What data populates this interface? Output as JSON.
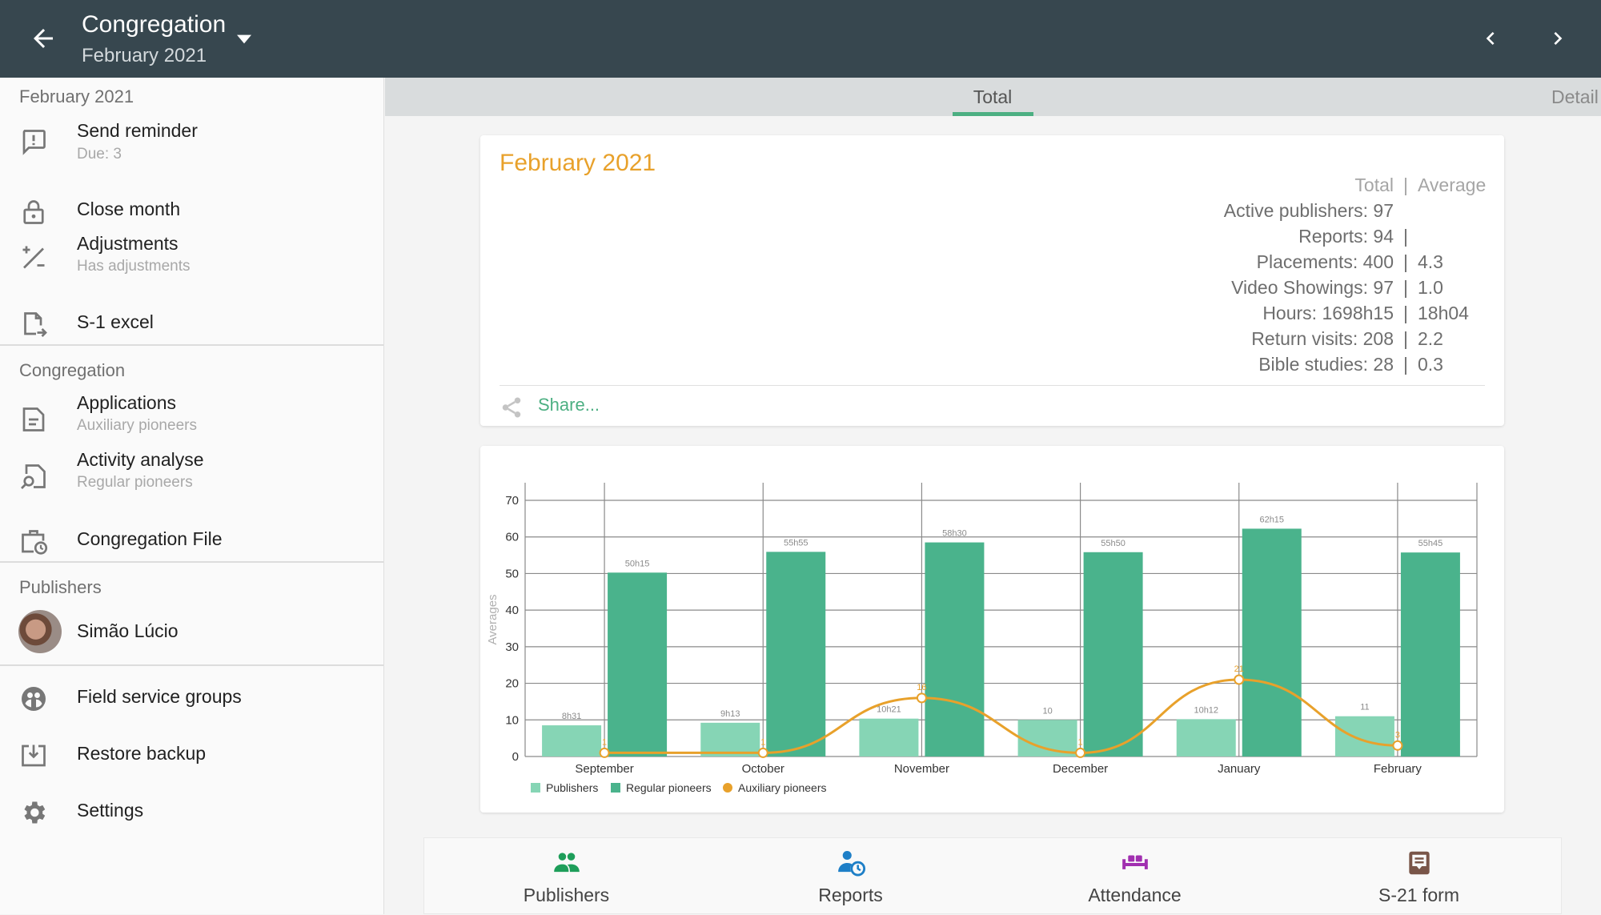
{
  "appbar": {
    "title": "Congregation",
    "subtitle": "February 2021",
    "back_icon": "arrow-left-icon",
    "dropdown_icon": "caret-down-icon",
    "prev_icon": "chevron-left-icon",
    "next_icon": "chevron-right-icon",
    "color": "#37474f"
  },
  "sidebar": {
    "sections": [
      {
        "header": "February 2021",
        "items": [
          {
            "label": "Send reminder",
            "sub": "Due: 3",
            "icon": "feedback-icon"
          },
          {
            "label": "Close month",
            "sub": "",
            "icon": "lock-icon"
          },
          {
            "label": "Adjustments",
            "sub": "Has adjustments",
            "icon": "plus-minus-icon"
          },
          {
            "label": "S-1 excel",
            "sub": "",
            "icon": "file-export-icon"
          }
        ]
      },
      {
        "header": "Congregation",
        "items": [
          {
            "label": "Applications",
            "sub": "Auxiliary pioneers",
            "icon": "document-icon"
          },
          {
            "label": "Activity analyse",
            "sub": "Regular pioneers",
            "icon": "file-search-icon"
          },
          {
            "label": "Congregation File",
            "sub": "",
            "icon": "briefcase-clock-icon"
          }
        ]
      },
      {
        "header": "Publishers",
        "items": [
          {
            "label": "Simão Lúcio",
            "sub": "",
            "icon": "avatar"
          }
        ]
      }
    ],
    "bottom_items": [
      {
        "label": "Field service groups",
        "icon": "groups-icon"
      },
      {
        "label": "Restore backup",
        "icon": "restore-icon"
      },
      {
        "label": "Settings",
        "icon": "gear-icon"
      }
    ]
  },
  "tabs": {
    "items": [
      "Total",
      "Detail"
    ],
    "active": "Total",
    "accent": "#4caf82"
  },
  "summary": {
    "month": "February 2021",
    "header_total": "Total",
    "header_average": "Average",
    "rows": [
      {
        "label": "Active publishers: 97",
        "avg": "",
        "sep": ""
      },
      {
        "label": "Reports: 94",
        "avg": "",
        "sep": "|"
      },
      {
        "label": "Placements: 400",
        "avg": "4.3",
        "sep": "|"
      },
      {
        "label": "Video Showings: 97",
        "avg": "1.0",
        "sep": "|"
      },
      {
        "label": "Hours: 1698h15",
        "avg": "18h04",
        "sep": "|"
      },
      {
        "label": "Return visits: 208",
        "avg": "2.2",
        "sep": "|"
      },
      {
        "label": "Bible studies: 28",
        "avg": "0.3",
        "sep": "|"
      }
    ],
    "share_label": "Share...",
    "month_color": "#e8a12b"
  },
  "chart_data": {
    "type": "bar",
    "title": "",
    "xlabel": "",
    "ylabel": "Averages",
    "ylim": [
      0,
      70
    ],
    "yticks": [
      0,
      10,
      20,
      30,
      40,
      50,
      60,
      70
    ],
    "grid": true,
    "legend": "bottom-left",
    "categories": [
      "September",
      "October",
      "November",
      "December",
      "January",
      "February"
    ],
    "series": [
      {
        "name": "Publishers",
        "type": "bar",
        "color": "#86d5b5",
        "values": [
          8.52,
          9.22,
          10.35,
          10,
          10.2,
          11
        ],
        "labels": [
          "8h31",
          "9h13",
          "10h21",
          "10",
          "10h12",
          "11"
        ]
      },
      {
        "name": "Regular pioneers",
        "type": "bar",
        "color": "#4ab38c",
        "values": [
          50.25,
          55.92,
          58.5,
          55.83,
          62.25,
          55.75
        ],
        "labels": [
          "50h15",
          "55h55",
          "58h30",
          "55h50",
          "62h15",
          "55h45"
        ]
      },
      {
        "name": "Auxiliary pioneers",
        "type": "line",
        "color": "#e8a12b",
        "values": [
          1,
          1,
          16,
          1,
          21,
          3
        ],
        "labels": [
          "1",
          "1",
          "16",
          "1",
          "21",
          "3"
        ]
      }
    ]
  },
  "bottomnav": {
    "items": [
      {
        "label": "Publishers",
        "icon": "people-icon",
        "color": "#1e9e5a"
      },
      {
        "label": "Reports",
        "icon": "person-clock-icon",
        "color": "#1e7fc7"
      },
      {
        "label": "Attendance",
        "icon": "seats-icon",
        "color": "#a12fb0"
      },
      {
        "label": "S-21 form",
        "icon": "form-icon",
        "color": "#795548"
      }
    ]
  }
}
